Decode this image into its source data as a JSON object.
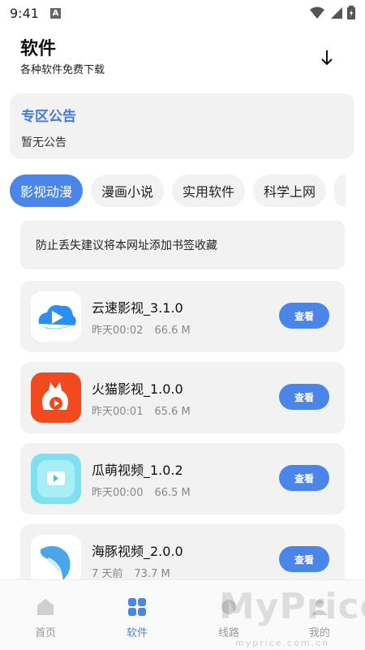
{
  "status_bar": {
    "time": "9:41",
    "a_label": "A"
  },
  "header": {
    "title": "软件",
    "subtitle": "各种软件免费下载"
  },
  "announcement": {
    "title": "专区公告",
    "body": "暂无公告"
  },
  "tabs": [
    {
      "label": "影视动漫",
      "active": true
    },
    {
      "label": "漫画小说",
      "active": false
    },
    {
      "label": "实用软件",
      "active": false
    },
    {
      "label": "科学上网",
      "active": false
    }
  ],
  "notice": "防止丢失建议将本网址添加书签收藏",
  "apps": [
    {
      "name": "云速影视_3.1.0",
      "time": "昨天00:02",
      "size": "66.6 M",
      "button": "查看",
      "icon": "cloud-play-icon"
    },
    {
      "name": "火猫影视_1.0.0",
      "time": "昨天00:01",
      "size": "65.6 M",
      "button": "查看",
      "icon": "fire-cat-icon"
    },
    {
      "name": "瓜萌视频_1.0.2",
      "time": "昨天00:00",
      "size": "66.5 M",
      "button": "查看",
      "icon": "tv-play-icon"
    },
    {
      "name": "海豚视频_2.0.0",
      "time": "7 天前",
      "size": "73.7 M",
      "button": "查看",
      "icon": "dolphin-icon"
    }
  ],
  "nav": {
    "home": "首页",
    "software": "软件",
    "lines": "线路",
    "mine": "我的"
  },
  "watermark": {
    "main": "MyPrice",
    "sub": "myprice.com.cn"
  },
  "colors": {
    "accent": "#4a86ea",
    "card_bg": "#f2f2f2",
    "announce_title": "#3f7be8"
  }
}
